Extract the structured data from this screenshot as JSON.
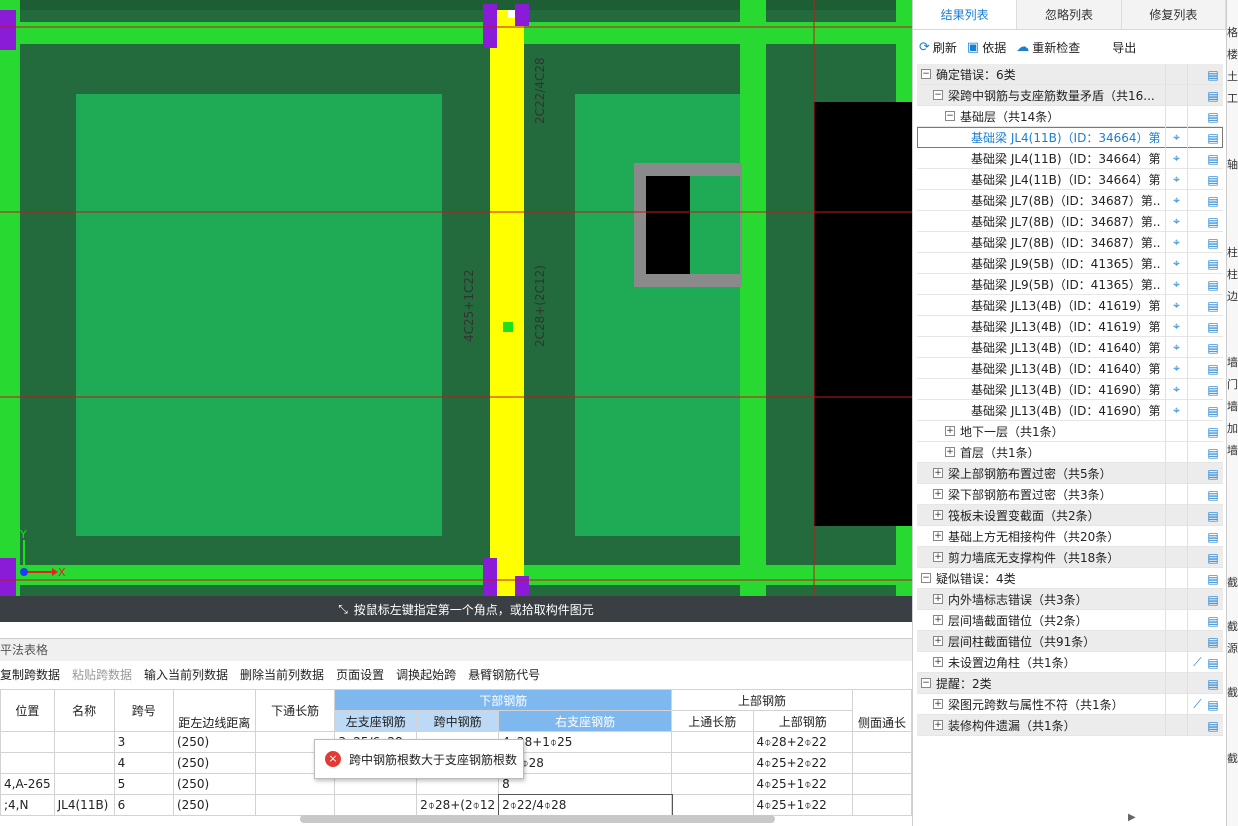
{
  "canvas": {
    "status_text": "按鼠标左键指定第一个角点，或拾取构件图元",
    "labels": {
      "left_vertical": "4C25+1C22",
      "right_top": "2C22/4C28",
      "right_mid": "2C28+(2C12)"
    },
    "axis": {
      "y": "Y",
      "x": "X"
    }
  },
  "right_panel": {
    "tabs": [
      "结果列表",
      "忽略列表",
      "修复列表"
    ],
    "toolbar": {
      "refresh": "刷新",
      "basis": "依据",
      "recheck": "重新检查",
      "export": "导出"
    },
    "tree": [
      {
        "label": "确定错误：6类",
        "toggle": "−",
        "indent": 0,
        "shaded": true
      },
      {
        "label": "梁跨中钢筋与支座筋数量矛盾（共16...",
        "toggle": "−",
        "indent": 1,
        "shaded": true
      },
      {
        "label": "基础层（共14条）",
        "toggle": "−",
        "indent": 2,
        "shaded": false
      },
      {
        "label": "基础梁 JL4(11B)（ID：34664）第...",
        "indent": 3,
        "locate": true,
        "selected": true
      },
      {
        "label": "基础梁 JL4(11B)（ID：34664）第...",
        "indent": 3,
        "locate": true
      },
      {
        "label": "基础梁 JL4(11B)（ID：34664）第...",
        "indent": 3,
        "locate": true
      },
      {
        "label": "基础梁 JL7(8B)（ID：34687）第...",
        "indent": 3,
        "locate": true
      },
      {
        "label": "基础梁 JL7(8B)（ID：34687）第...",
        "indent": 3,
        "locate": true
      },
      {
        "label": "基础梁 JL7(8B)（ID：34687）第...",
        "indent": 3,
        "locate": true
      },
      {
        "label": "基础梁 JL9(5B)（ID：41365）第...",
        "indent": 3,
        "locate": true
      },
      {
        "label": "基础梁 JL9(5B)（ID：41365）第...",
        "indent": 3,
        "locate": true
      },
      {
        "label": "基础梁 JL13(4B)（ID：41619）第...",
        "indent": 3,
        "locate": true
      },
      {
        "label": "基础梁 JL13(4B)（ID：41619）第...",
        "indent": 3,
        "locate": true
      },
      {
        "label": "基础梁 JL13(4B)（ID：41640）第...",
        "indent": 3,
        "locate": true
      },
      {
        "label": "基础梁 JL13(4B)（ID：41640）第...",
        "indent": 3,
        "locate": true
      },
      {
        "label": "基础梁 JL13(4B)（ID：41690）第...",
        "indent": 3,
        "locate": true
      },
      {
        "label": "基础梁 JL13(4B)（ID：41690）第...",
        "indent": 3,
        "locate": true
      },
      {
        "label": "地下一层（共1条）",
        "toggle": "+",
        "indent": 2
      },
      {
        "label": "首层（共1条）",
        "toggle": "+",
        "indent": 2
      },
      {
        "label": "梁上部钢筋布置过密（共5条）",
        "toggle": "+",
        "indent": 1,
        "shaded": true
      },
      {
        "label": "梁下部钢筋布置过密（共3条）",
        "toggle": "+",
        "indent": 1
      },
      {
        "label": "筏板未设置变截面（共2条）",
        "toggle": "+",
        "indent": 1,
        "shaded": true
      },
      {
        "label": "基础上方无相接构件（共20条）",
        "toggle": "+",
        "indent": 1
      },
      {
        "label": "剪力墙底无支撑构件（共18条）",
        "toggle": "+",
        "indent": 1,
        "shaded": true
      },
      {
        "label": "疑似错误：4类",
        "toggle": "−",
        "indent": 0
      },
      {
        "label": "内外墙标志错误（共3条）",
        "toggle": "+",
        "indent": 1,
        "shaded": true
      },
      {
        "label": "层间墙截面错位（共2条）",
        "toggle": "+",
        "indent": 1
      },
      {
        "label": "层间柱截面错位（共91条）",
        "toggle": "+",
        "indent": 1,
        "shaded": true
      },
      {
        "label": "未设置边角柱（共1条）",
        "toggle": "+",
        "indent": 1,
        "fix": true
      },
      {
        "label": "提醒：2类",
        "toggle": "−",
        "indent": 0,
        "shaded": true
      },
      {
        "label": "梁图元跨数与属性不符（共1条）",
        "toggle": "+",
        "indent": 1,
        "fix": true
      },
      {
        "label": "装修构件遗漏（共1条）",
        "toggle": "+",
        "indent": 1,
        "shaded": true
      }
    ],
    "edge_glyphs": [
      "",
      "格",
      "楼",
      "土",
      "工",
      "",
      "",
      "轴",
      "",
      "",
      "",
      "柱",
      "柱",
      "边",
      "",
      "",
      "墙",
      "门",
      "墙",
      "加",
      "墙",
      "",
      "",
      "",
      "",
      "",
      "截",
      "",
      "截",
      "源",
      "",
      "截",
      "",
      "",
      "截"
    ]
  },
  "bottom": {
    "title": "平法表格",
    "toolbar": [
      "复制跨数据",
      "粘贴跨数据",
      "输入当前列数据",
      "删除当前列数据",
      "页面设置",
      "调换起始跨",
      "悬臂钢筋代号"
    ],
    "toolbar_disabled": [
      false,
      true,
      false,
      false,
      false,
      false,
      false
    ],
    "headers": {
      "position": "位置",
      "name": "名称",
      "span": "跨号",
      "dist": "距左边线距离",
      "bottom_through": "下通长筋",
      "bottom_group": "下部钢筋",
      "left_support": "左支座钢筋",
      "mid_span": "跨中钢筋",
      "right_support": "右支座钢筋",
      "top_group": "上部钢筋",
      "top_through": "上通长筋",
      "top_bar": "上部钢筋",
      "side": "侧面通长"
    },
    "rows": [
      {
        "pos": "",
        "name": "",
        "span": "3",
        "dist": "(250)",
        "through": "",
        "left": "3⌽25/6⌽28",
        "mid": "",
        "right": "4⌽28+1⌽25",
        "top_through": "",
        "top": "4⌽28+2⌽22"
      },
      {
        "pos": "",
        "name": "",
        "span": "4",
        "dist": "(250)",
        "through": "",
        "left": "",
        "mid": "",
        "right": "5/6⌽28",
        "top_through": "",
        "top": "4⌽25+2⌽22"
      },
      {
        "pos": "4,A-265",
        "name": "",
        "span": "5",
        "dist": "(250)",
        "through": "",
        "left": "",
        "mid": "",
        "right": "8",
        "top_through": "",
        "top": "4⌽25+1⌽22"
      },
      {
        "pos": ";4,N",
        "name": "JL4(11B)",
        "span": "6",
        "dist": "(250)",
        "through": "",
        "left": "",
        "mid": "2⌽28+(2⌽12",
        "right": "2⌽22/4⌽28",
        "top_through": "",
        "top": "4⌽25+1⌽22"
      }
    ],
    "tooltip": "跨中钢筋根数大于支座钢筋根数"
  }
}
